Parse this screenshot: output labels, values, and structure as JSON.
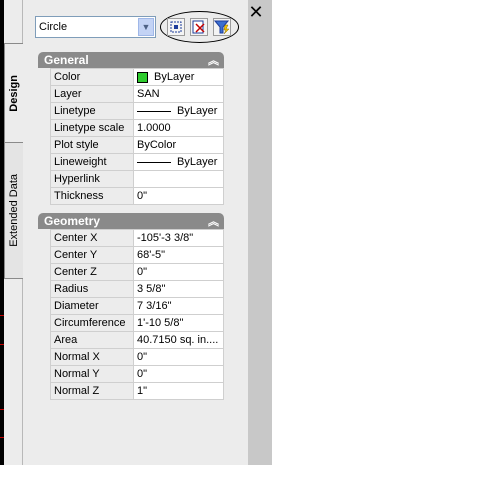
{
  "object_select": {
    "value": "Circle"
  },
  "toolbar": [
    {
      "name": "toggle-pickadd-button",
      "icon": "pickadd-icon"
    },
    {
      "name": "select-objects-button",
      "icon": "select-objects-icon"
    },
    {
      "name": "quick-select-button",
      "icon": "quick-select-filter-icon"
    }
  ],
  "close_label": "✕",
  "tabs": {
    "design": "Design",
    "extended": "Extended Data"
  },
  "general": {
    "title": "General",
    "rows": [
      {
        "label": "Color",
        "value": "ByLayer",
        "swatch": "#2ecc2e"
      },
      {
        "label": "Layer",
        "value": "SAN"
      },
      {
        "label": "Linetype",
        "value": "ByLayer",
        "line": true
      },
      {
        "label": "Linetype scale",
        "value": "1.0000"
      },
      {
        "label": "Plot style",
        "value": "ByColor"
      },
      {
        "label": "Lineweight",
        "value": "ByLayer",
        "line": true
      },
      {
        "label": "Hyperlink",
        "value": ""
      },
      {
        "label": "Thickness",
        "value": "0\""
      }
    ]
  },
  "geometry": {
    "title": "Geometry",
    "rows": [
      {
        "label": "Center X",
        "value": "-105'-3 3/8\""
      },
      {
        "label": "Center Y",
        "value": "68'-5\""
      },
      {
        "label": "Center Z",
        "value": "0\""
      },
      {
        "label": "Radius",
        "value": "3 5/8\""
      },
      {
        "label": "Diameter",
        "value": "7 3/16\""
      },
      {
        "label": "Circumference",
        "value": "1'-10 5/8\""
      },
      {
        "label": "Area",
        "value": "40.7150 sq. in...."
      },
      {
        "label": "Normal X",
        "value": "0\""
      },
      {
        "label": "Normal Y",
        "value": "0\""
      },
      {
        "label": "Normal Z",
        "value": "1\""
      }
    ]
  }
}
